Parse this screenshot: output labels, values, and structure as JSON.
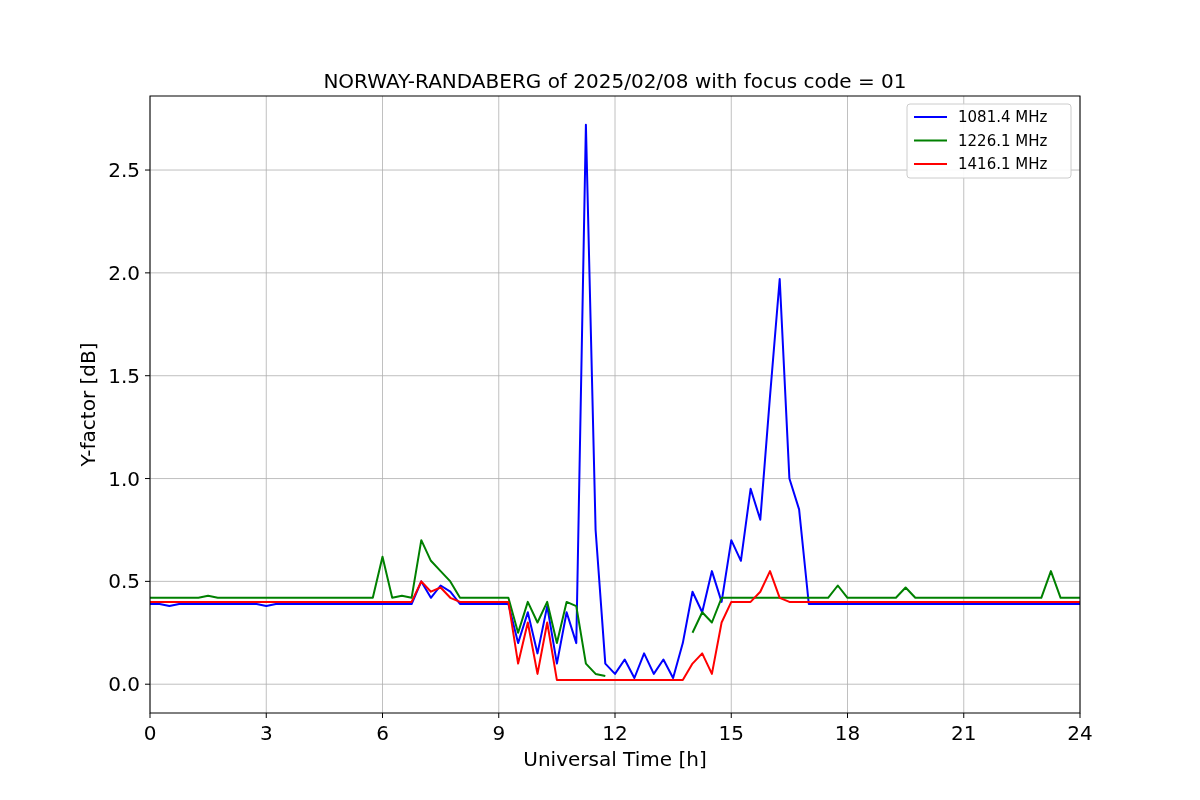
{
  "chart_data": {
    "type": "line",
    "title": "NORWAY-RANDABERG of 2025/02/08 with focus code = 01",
    "xlabel": "Universal Time [h]",
    "ylabel": "Y-factor [dB]",
    "x": [
      0,
      0.25,
      0.5,
      0.75,
      1,
      1.25,
      1.5,
      1.75,
      2,
      2.25,
      2.5,
      2.75,
      3,
      3.25,
      3.5,
      3.75,
      4,
      4.25,
      4.5,
      4.75,
      5,
      5.25,
      5.5,
      5.75,
      6,
      6.25,
      6.5,
      6.75,
      7,
      7.25,
      7.5,
      7.75,
      8,
      8.25,
      8.5,
      8.75,
      9,
      9.25,
      9.5,
      9.75,
      10,
      10.25,
      10.5,
      10.75,
      11,
      11.25,
      11.5,
      11.75,
      12,
      12.25,
      12.5,
      12.75,
      13,
      13.25,
      13.5,
      13.75,
      14,
      14.25,
      14.5,
      14.75,
      15,
      15.25,
      15.5,
      15.75,
      16,
      16.25,
      16.5,
      16.75,
      17,
      17.25,
      17.5,
      17.75,
      18,
      18.25,
      18.5,
      18.75,
      19,
      19.25,
      19.5,
      19.75,
      20,
      20.25,
      20.5,
      20.75,
      21,
      21.25,
      21.5,
      21.75,
      22,
      22.25,
      22.5,
      22.75,
      23,
      23.25,
      23.5,
      23.75,
      24
    ],
    "series": [
      {
        "name": "1081.4 MHz",
        "color": "#0000ff",
        "values": [
          0.39,
          0.39,
          0.38,
          0.39,
          0.39,
          0.39,
          0.39,
          0.39,
          0.39,
          0.39,
          0.39,
          0.39,
          0.38,
          0.39,
          0.39,
          0.39,
          0.39,
          0.39,
          0.39,
          0.39,
          0.39,
          0.39,
          0.39,
          0.39,
          0.39,
          0.39,
          0.39,
          0.39,
          0.5,
          0.42,
          0.48,
          0.45,
          0.39,
          0.39,
          0.39,
          0.39,
          0.39,
          0.39,
          0.2,
          0.35,
          0.15,
          0.38,
          0.1,
          0.35,
          0.2,
          2.72,
          0.75,
          0.1,
          0.05,
          0.12,
          0.03,
          0.15,
          0.05,
          0.12,
          0.03,
          0.2,
          0.45,
          0.35,
          0.55,
          0.4,
          0.7,
          0.6,
          0.95,
          0.8,
          1.4,
          1.97,
          1.0,
          0.85,
          0.39,
          0.39,
          0.39,
          0.39,
          0.39,
          0.39,
          0.39,
          0.39,
          0.39,
          0.39,
          0.39,
          0.39,
          0.39,
          0.39,
          0.39,
          0.39,
          0.39,
          0.39,
          0.39,
          0.39,
          0.39,
          0.39,
          0.39,
          0.39,
          0.39,
          0.39,
          0.39,
          0.39,
          0.39
        ]
      },
      {
        "name": "1226.1 MHz",
        "color": "#008000",
        "values": [
          0.42,
          0.42,
          0.42,
          0.42,
          0.42,
          0.42,
          0.43,
          0.42,
          0.42,
          0.42,
          0.42,
          0.42,
          0.42,
          0.42,
          0.42,
          0.42,
          0.42,
          0.42,
          0.42,
          0.42,
          0.42,
          0.42,
          0.42,
          0.42,
          0.62,
          0.42,
          0.43,
          0.42,
          0.7,
          0.6,
          0.55,
          0.5,
          0.42,
          0.42,
          0.42,
          0.42,
          0.42,
          0.42,
          0.25,
          0.4,
          0.3,
          0.4,
          0.2,
          0.4,
          0.38,
          0.1,
          0.05,
          0.04,
          null,
          null,
          null,
          null,
          null,
          null,
          null,
          null,
          0.25,
          0.35,
          0.3,
          0.42,
          0.42,
          0.42,
          0.42,
          0.42,
          0.42,
          0.42,
          0.42,
          0.42,
          0.42,
          0.42,
          0.42,
          0.48,
          0.42,
          0.42,
          0.42,
          0.42,
          0.42,
          0.42,
          0.47,
          0.42,
          0.42,
          0.42,
          0.42,
          0.42,
          0.42,
          0.42,
          0.42,
          0.42,
          0.42,
          0.42,
          0.42,
          0.42,
          0.42,
          0.55,
          0.42,
          0.42,
          0.42
        ]
      },
      {
        "name": "1416.1 MHz",
        "color": "#ff0000",
        "values": [
          0.4,
          0.4,
          0.4,
          0.4,
          0.4,
          0.4,
          0.4,
          0.4,
          0.4,
          0.4,
          0.4,
          0.4,
          0.4,
          0.4,
          0.4,
          0.4,
          0.4,
          0.4,
          0.4,
          0.4,
          0.4,
          0.4,
          0.4,
          0.4,
          0.4,
          0.4,
          0.4,
          0.4,
          0.5,
          0.45,
          0.47,
          0.42,
          0.4,
          0.4,
          0.4,
          0.4,
          0.4,
          0.4,
          0.1,
          0.3,
          0.05,
          0.3,
          0.02,
          0.02,
          0.02,
          0.02,
          0.02,
          0.02,
          0.02,
          0.02,
          0.02,
          0.02,
          0.02,
          0.02,
          0.02,
          0.02,
          0.1,
          0.15,
          0.05,
          0.3,
          0.4,
          0.4,
          0.4,
          0.45,
          0.55,
          0.42,
          0.4,
          0.4,
          0.4,
          0.4,
          0.4,
          0.4,
          0.4,
          0.4,
          0.4,
          0.4,
          0.4,
          0.4,
          0.4,
          0.4,
          0.4,
          0.4,
          0.4,
          0.4,
          0.4,
          0.4,
          0.4,
          0.4,
          0.4,
          0.4,
          0.4,
          0.4,
          0.4,
          0.4,
          0.4,
          0.4,
          0.4
        ]
      }
    ],
    "xlim": [
      0,
      24
    ],
    "ylim": [
      -0.14,
      2.86
    ],
    "xticks": [
      0,
      3,
      6,
      9,
      12,
      15,
      18,
      21,
      24
    ],
    "yticks": [
      {
        "value": 0,
        "label": "0.0"
      },
      0.5,
      {
        "value": 1,
        "label": "1.0"
      },
      1.5,
      {
        "value": 2,
        "label": "2.0"
      },
      2.5
    ],
    "grid": true,
    "legend": true
  }
}
